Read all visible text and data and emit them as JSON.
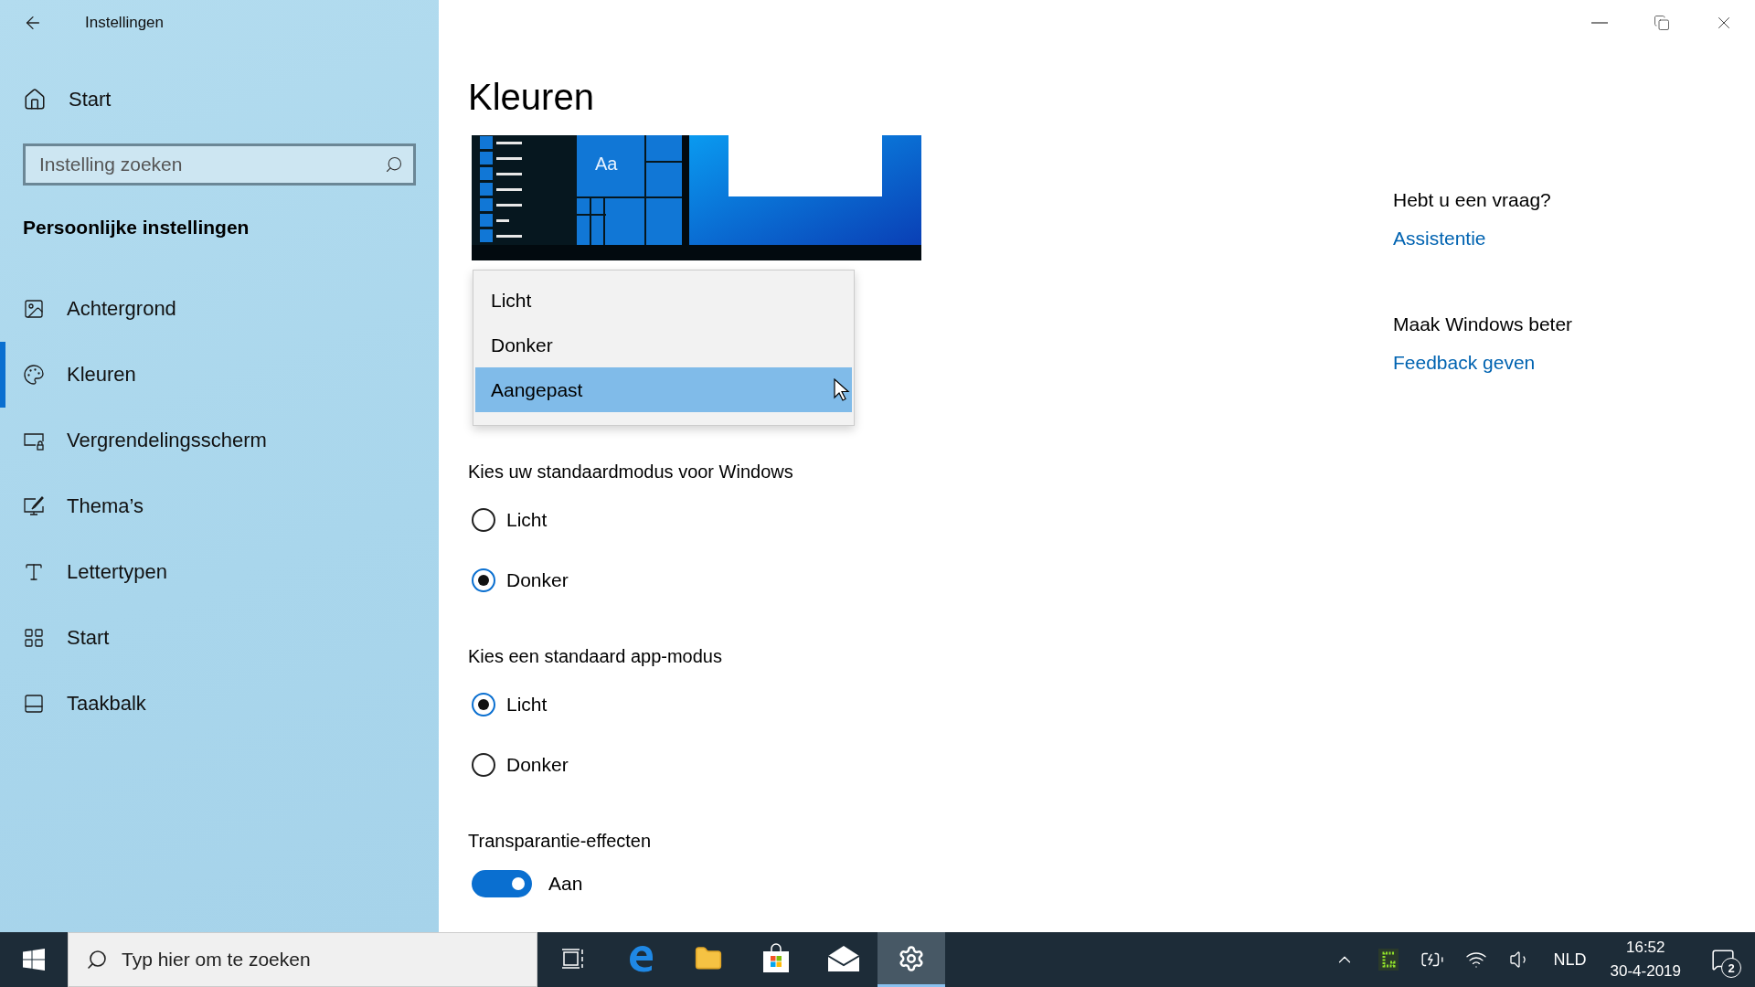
{
  "window": {
    "title": "Instellingen"
  },
  "sidebar": {
    "home": "Start",
    "search": {
      "placeholder": "Instelling zoeken"
    },
    "section": "Persoonlijke instellingen",
    "items": [
      {
        "kind": "background",
        "label": "Achtergrond",
        "selected": false
      },
      {
        "kind": "colors",
        "label": "Kleuren",
        "selected": true
      },
      {
        "kind": "lockscreen",
        "label": "Vergrendelingsscherm",
        "selected": false
      },
      {
        "kind": "themes",
        "label": "Thema’s",
        "selected": false
      },
      {
        "kind": "fonts",
        "label": "Lettertypen",
        "selected": false
      },
      {
        "kind": "start",
        "label": "Start",
        "selected": false
      },
      {
        "kind": "taskbar",
        "label": "Taakbalk",
        "selected": false
      }
    ]
  },
  "page": {
    "title": "Kleuren",
    "preview_text": "Aa",
    "dropdown": {
      "options": [
        {
          "label": "Licht",
          "selected": false
        },
        {
          "label": "Donker",
          "selected": false
        },
        {
          "label": "Aangepast",
          "selected": true
        }
      ]
    },
    "groups": [
      {
        "label": "Kies uw standaardmodus voor Windows",
        "options": [
          {
            "label": "Licht",
            "selected": false
          },
          {
            "label": "Donker",
            "selected": true
          }
        ]
      },
      {
        "label": "Kies een standaard app-modus",
        "options": [
          {
            "label": "Licht",
            "selected": true
          },
          {
            "label": "Donker",
            "selected": false
          }
        ]
      }
    ],
    "transparency": {
      "label": "Transparantie-effecten",
      "on": true,
      "state_text": "Aan"
    }
  },
  "help": [
    {
      "heading": "Hebt u een vraag?",
      "link": "Assistentie"
    },
    {
      "heading": "Maak Windows beter",
      "link": "Feedback geven"
    }
  ],
  "taskbar": {
    "search": {
      "placeholder": "Typ hier om te zoeken"
    },
    "apps": [
      {
        "kind": "taskview",
        "selected": false
      },
      {
        "kind": "edge",
        "selected": false
      },
      {
        "kind": "explorer",
        "selected": false
      },
      {
        "kind": "store",
        "selected": false
      },
      {
        "kind": "mail",
        "selected": false
      },
      {
        "kind": "settings",
        "selected": true
      }
    ],
    "language": "NLD",
    "time": "16:52",
    "date": "30-4-2019",
    "notifications": "2"
  }
}
